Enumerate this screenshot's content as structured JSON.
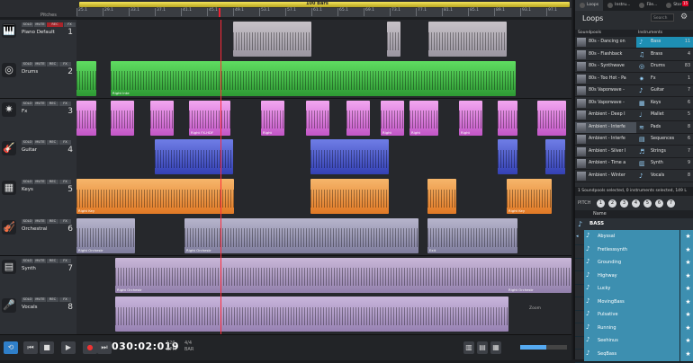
{
  "timeline": {
    "loop_label": "100 Bars",
    "ticks": [
      "25.1",
      "29.1",
      "33.1",
      "37.1",
      "41.1",
      "45.1",
      "49.1",
      "53.1",
      "57.1",
      "61.1",
      "65.1",
      "69.1",
      "73.1",
      "77.1",
      "81.1",
      "85.1",
      "89.1",
      "93.1",
      "97.1"
    ],
    "pitches_label": "Pitches"
  },
  "track_buttons": {
    "solo": "SOLO",
    "mute": "MUTE",
    "rec": "REC",
    "fx": "FX"
  },
  "tracks": [
    {
      "name": "Piano Default",
      "num": "1",
      "icon": "🎹",
      "icon_name": "piano-icon"
    },
    {
      "name": "Drums",
      "num": "2",
      "icon": "◎",
      "icon_name": "drum-icon"
    },
    {
      "name": "Fx",
      "num": "3",
      "icon": "✷",
      "icon_name": "fx-icon"
    },
    {
      "name": "Guitar",
      "num": "4",
      "icon": "🎸",
      "icon_name": "guitar-icon"
    },
    {
      "name": "Keys",
      "num": "5",
      "icon": "▦",
      "icon_name": "keys-icon"
    },
    {
      "name": "Orchestral",
      "num": "6",
      "icon": "🎻",
      "icon_name": "violin-icon"
    },
    {
      "name": "Synth",
      "num": "7",
      "icon": "▤",
      "icon_name": "synth-icon"
    },
    {
      "name": "Vocals",
      "num": "8",
      "icon": "🎤",
      "icon_name": "microphone-icon"
    }
  ],
  "clip_labels": {
    "drums": "Right Inte",
    "fx": "Right FX-HDF",
    "fx2": "Right",
    "keys": "Right Key",
    "orch": "Right Orchestr",
    "orch2": "Exit",
    "synth": "Right Orchestr",
    "synth2": "Right Orchestr"
  },
  "transport": {
    "loop": "⟲",
    "rewind": "⏮",
    "stop": "■",
    "play": "▶",
    "record": "●",
    "forward": "⏭",
    "time": "030:02:019",
    "tempo_bpm": "120",
    "tempo_label": "BPM",
    "signature": "4/4",
    "sig_label": "BAR",
    "zoom": "Zoom",
    "volume": 0.55
  },
  "panel": {
    "tabs": [
      {
        "label": "Loops",
        "icon_name": "loops-tab-icon"
      },
      {
        "label": "Instru...",
        "icon_name": "instruments-tab-icon"
      },
      {
        "label": "File...",
        "icon_name": "file-tab-icon"
      },
      {
        "label": "Stor",
        "icon_name": "store-tab-icon"
      }
    ],
    "badge": "15",
    "title": "Loops",
    "search_placeholder": "Search",
    "col_soundpools": "Soundpools",
    "col_instruments": "Instruments",
    "soundpools": [
      "80s - Dancing on",
      "80s - Flashback",
      "80s - Synthwave",
      "80s - Too Hot - Pa",
      "80s Vaporwave -",
      "80s Vaporwave -",
      "Ambient - Deep I",
      "Ambient - Interfe",
      "Ambient - Interfe",
      "Ambient - Silver I",
      "Ambient - Time a",
      "Ambient - Winter"
    ],
    "instruments": [
      {
        "name": "Bass",
        "count": "11",
        "icon": "♪"
      },
      {
        "name": "Brass",
        "count": "4",
        "icon": "♫"
      },
      {
        "name": "Drums",
        "count": "83",
        "icon": "◎"
      },
      {
        "name": "Fx",
        "count": "1",
        "icon": "✷"
      },
      {
        "name": "Guitar",
        "count": "7",
        "icon": "♪"
      },
      {
        "name": "Keys",
        "count": "6",
        "icon": "▦"
      },
      {
        "name": "Mallet",
        "count": "5",
        "icon": "♩"
      },
      {
        "name": "Pads",
        "count": "8",
        "icon": "≋"
      },
      {
        "name": "Sequences",
        "count": "6",
        "icon": "▤"
      },
      {
        "name": "Strings",
        "count": "7",
        "icon": "♬"
      },
      {
        "name": "Synth",
        "count": "9",
        "icon": "▥"
      },
      {
        "name": "Vocals",
        "count": "8",
        "icon": "♪"
      }
    ],
    "selection_status": "1 Soundpools selected, 0 instruments selected, 149 L",
    "pitch_label": "PITCH",
    "pitches": [
      "1",
      "2",
      "3",
      "4",
      "5",
      "6",
      "7"
    ],
    "name_col": "Name",
    "group": "BASS",
    "loops": [
      "Abyssal",
      "Fretlesssynth",
      "Grounding",
      "Highway",
      "Lucky",
      "MovingBass",
      "Pulsative",
      "Running",
      "Seehinus",
      "SeqBass"
    ]
  }
}
